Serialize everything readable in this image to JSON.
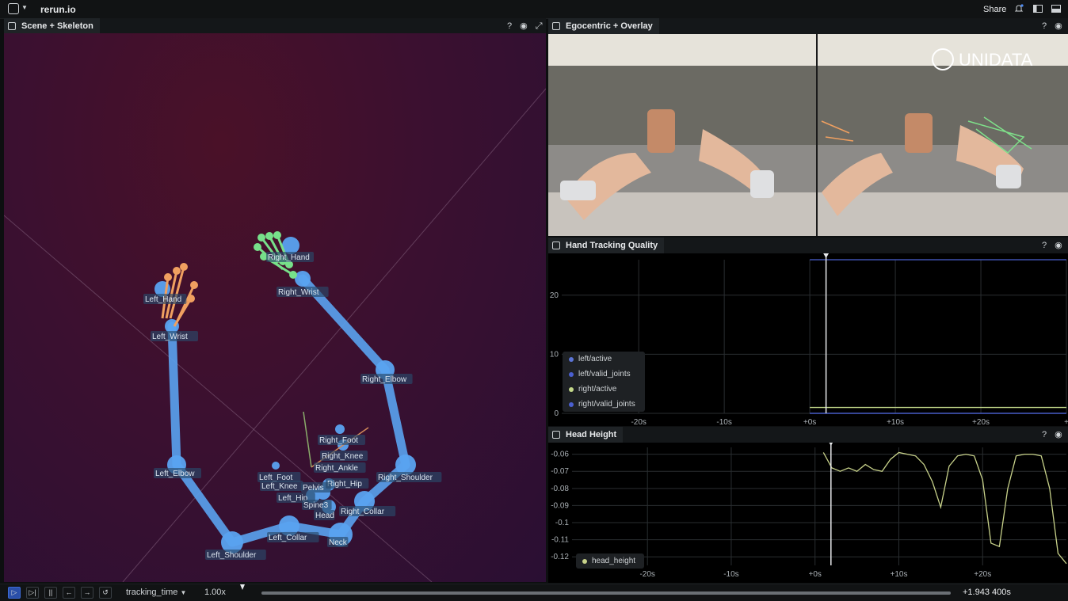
{
  "app": {
    "title": "rerun.io",
    "share_label": "Share"
  },
  "panels": {
    "scene": {
      "title": "Scene + Skeleton"
    },
    "video": {
      "title": "Egocentric + Overlay",
      "watermark": "UNIDATA"
    },
    "hand_quality": {
      "title": "Hand Tracking Quality",
      "legend": [
        {
          "label": "left/active",
          "color": "#5b74d6"
        },
        {
          "label": "left/valid_joints",
          "color": "#4a5fd0"
        },
        {
          "label": "right/active",
          "color": "#c4d98a"
        },
        {
          "label": "right/valid_joints",
          "color": "#4a5fd0"
        }
      ]
    },
    "head_height": {
      "title": "Head Height",
      "legend": [
        {
          "label": "head_height",
          "color": "#c8d28a"
        }
      ]
    }
  },
  "skeleton_labels": [
    "Right_Hand",
    "Right_Wrist",
    "Left_Hand",
    "Left_Wrist",
    "Right_Elbow",
    "Right_Foot",
    "Right_Knee",
    "Right_Ankle",
    "Right_Hip",
    "Right_Shoulder",
    "Left_Foot",
    "Left_Knee",
    "Pelvis",
    "Left_Hip",
    "Spine3",
    "Head",
    "Right_Collar",
    "Left_Elbow",
    "Left_Collar",
    "Neck",
    "Left_Shoulder"
  ],
  "chart_data": [
    {
      "type": "line",
      "title": "Hand Tracking Quality",
      "x_ticks": [
        "-20s",
        "-10s",
        "+0s",
        "+10s",
        "+20s",
        "+"
      ],
      "y_ticks": [
        "0",
        "10",
        "20"
      ],
      "ylim": [
        0,
        26
      ],
      "xlim": [
        -29,
        30
      ],
      "series": [
        {
          "name": "left/active",
          "x": [
            0,
            30
          ],
          "y": [
            0,
            0
          ]
        },
        {
          "name": "left/valid_joints",
          "x": [
            0,
            30
          ],
          "y": [
            0,
            0
          ]
        },
        {
          "name": "right/active",
          "x": [
            0,
            30
          ],
          "y": [
            1,
            1
          ]
        },
        {
          "name": "right/valid_joints",
          "x": [
            0,
            30
          ],
          "y": [
            26,
            26
          ]
        }
      ],
      "cursor_x": 1.9
    },
    {
      "type": "line",
      "title": "Head Height",
      "x_ticks": [
        "-20s",
        "-10s",
        "+0s",
        "+10s",
        "+20s"
      ],
      "y_ticks": [
        "-0.06",
        "-0.07",
        "-0.08",
        "-0.09",
        "-0.1",
        "-0.11",
        "-0.12"
      ],
      "ylim": [
        -0.125,
        -0.056
      ],
      "xlim": [
        -29,
        30
      ],
      "series": [
        {
          "name": "head_height",
          "x": [
            1.0,
            2.0,
            3.0,
            4.0,
            5.0,
            6.0,
            7.0,
            8.0,
            9.0,
            10.0,
            11.0,
            12.0,
            13.0,
            14.0,
            15.0,
            16.0,
            17.0,
            18.0,
            19.0,
            20.0,
            21.0,
            22.0,
            23.0,
            24.0,
            25.0,
            26.0,
            27.0,
            28.0,
            29.0,
            30.0
          ],
          "y": [
            -0.059,
            -0.068,
            -0.07,
            -0.068,
            -0.07,
            -0.066,
            -0.069,
            -0.07,
            -0.063,
            -0.059,
            -0.06,
            -0.061,
            -0.066,
            -0.076,
            -0.091,
            -0.067,
            -0.061,
            -0.06,
            -0.061,
            -0.075,
            -0.112,
            -0.114,
            -0.08,
            -0.061,
            -0.06,
            -0.06,
            -0.061,
            -0.08,
            -0.118,
            -0.124
          ]
        }
      ],
      "cursor_x": 1.9
    }
  ],
  "footer": {
    "timeline_name": "tracking_time",
    "speed": "1.00x",
    "time_readout": "+1.943 400s"
  }
}
